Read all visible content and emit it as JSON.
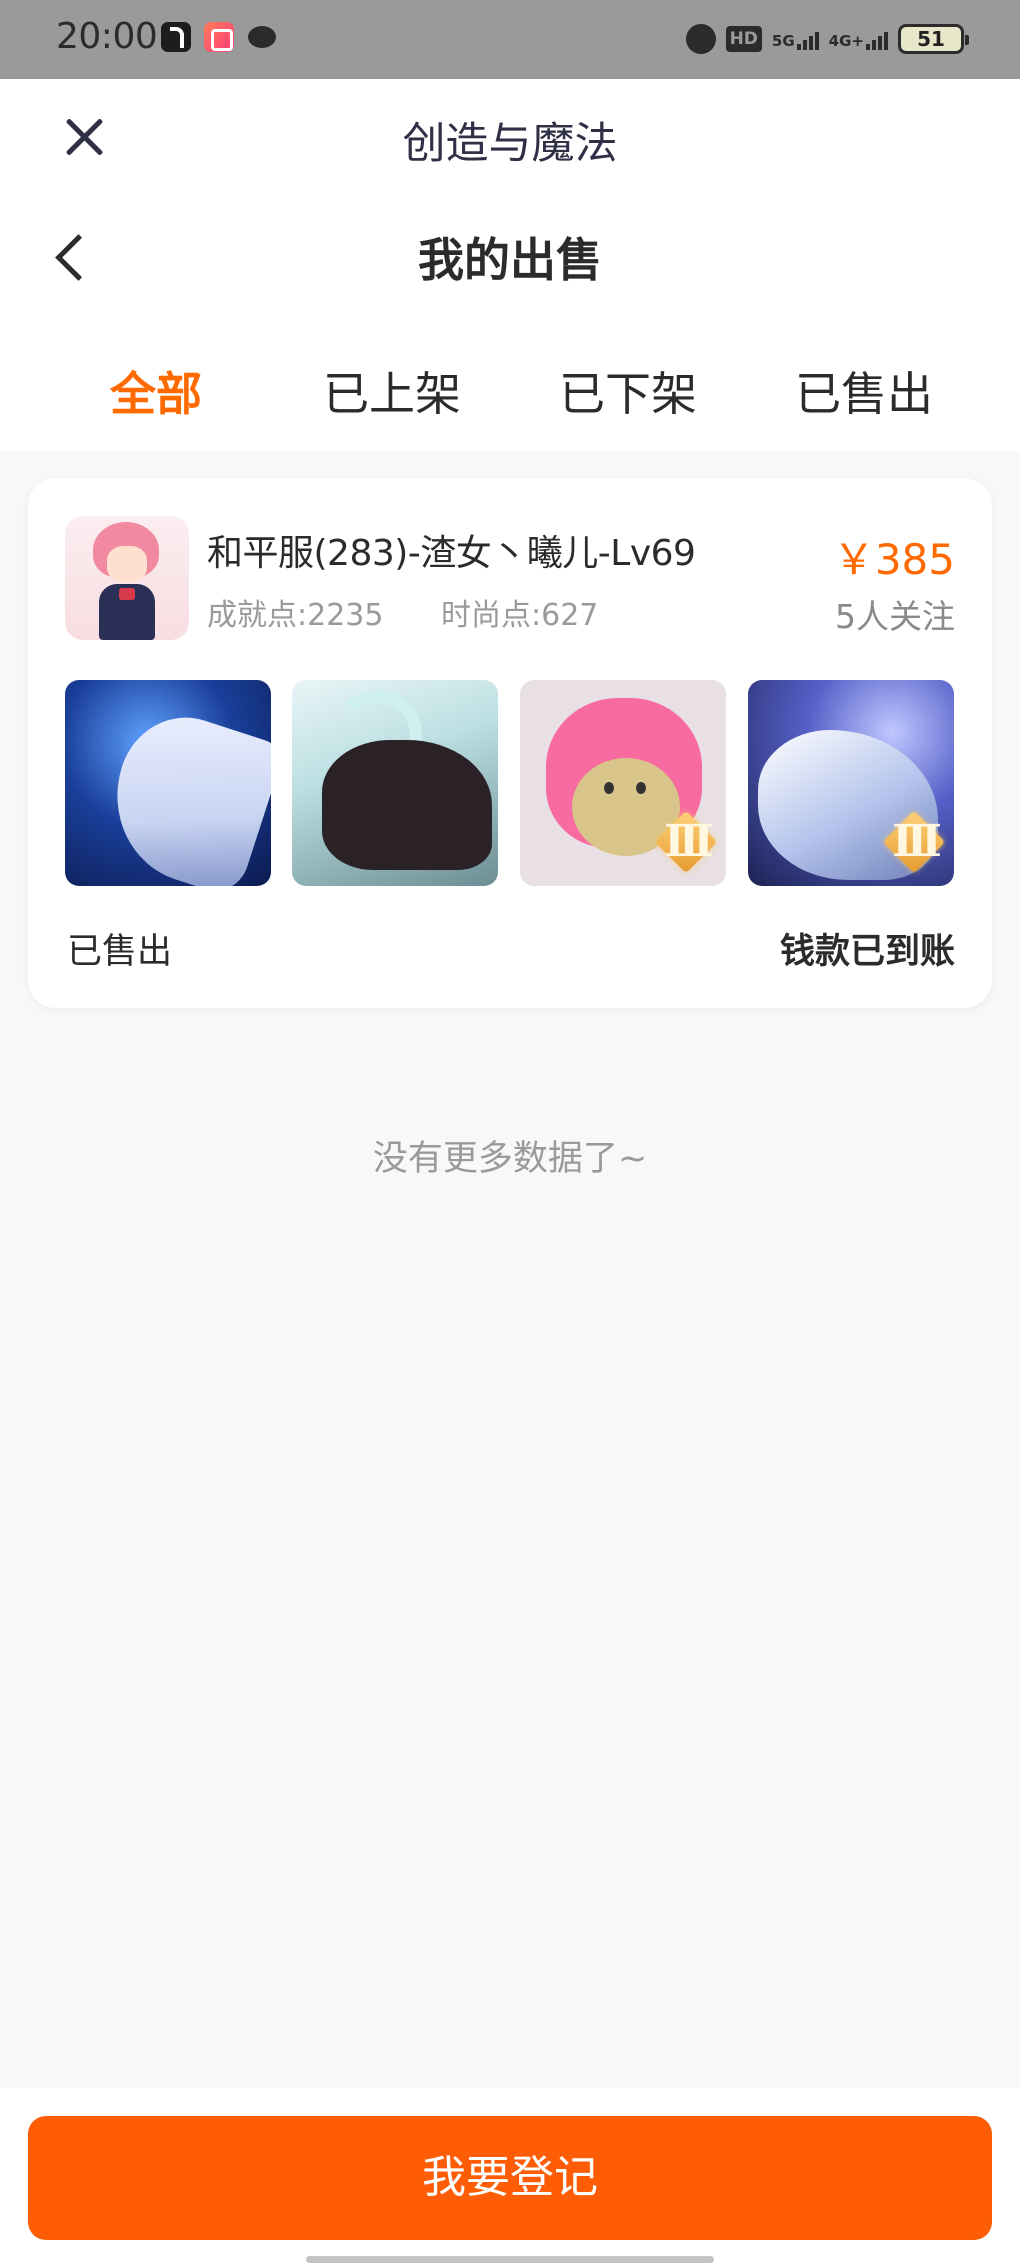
{
  "status_bar": {
    "time": "20:00",
    "hd_label": "HD",
    "network_5g": "5G",
    "network_4g": "4G+",
    "battery": "51"
  },
  "header": {
    "app_title": "创造与魔法",
    "page_title": "我的出售"
  },
  "tabs": [
    {
      "label": "全部",
      "active": true
    },
    {
      "label": "已上架",
      "active": false
    },
    {
      "label": "已下架",
      "active": false
    },
    {
      "label": "已售出",
      "active": false
    }
  ],
  "order": {
    "item_name": "和平服(283)-渣女丶曦儿-Lv69",
    "price": "￥385",
    "achievement_points": "成就点:2235",
    "fashion_points": "时尚点:627",
    "followers": "5人关注",
    "thumbnails": [
      {
        "icon": "blue-fox-mount-thumbnail",
        "tier": ""
      },
      {
        "icon": "bone-dragon-mount-thumbnail",
        "tier": ""
      },
      {
        "icon": "pink-bear-outfit-thumbnail",
        "tier": "III"
      },
      {
        "icon": "white-tiger-mount-thumbnail",
        "tier": "III"
      }
    ],
    "status": "已售出",
    "payment_status": "钱款已到账"
  },
  "list_end_text": "没有更多数据了~",
  "bottom": {
    "register_button": "我要登记"
  },
  "colors": {
    "accent": "#ff6a00",
    "button": "#fe5d05",
    "background": "#f8f8f8",
    "text": "#2b2b2b",
    "secondary_text": "#9a9a9a"
  }
}
